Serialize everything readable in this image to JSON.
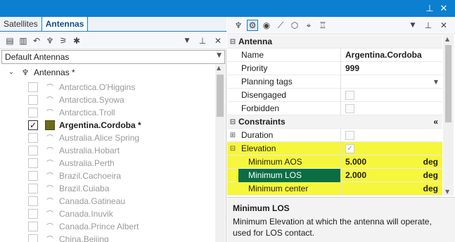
{
  "window": {
    "pin_icon": "pin-icon",
    "close_icon": "close-icon"
  },
  "left": {
    "tabs": [
      {
        "label": "Satellites"
      },
      {
        "label": "Antennas"
      }
    ],
    "filter": {
      "value": "Default Antennas"
    },
    "tree": {
      "root_label": "Antennas *",
      "items": [
        {
          "label": "Antarctica.O'Higgins",
          "checked": false,
          "bold": false
        },
        {
          "label": "Antarctica.Syowa",
          "checked": false,
          "bold": false
        },
        {
          "label": "Antarctica.Troll",
          "checked": false,
          "bold": false
        },
        {
          "label": "Argentina.Cordoba *",
          "checked": true,
          "bold": true
        },
        {
          "label": "Australia.Alice Spring",
          "checked": false,
          "bold": false
        },
        {
          "label": "Australia.Hobart",
          "checked": false,
          "bold": false
        },
        {
          "label": "Australia.Perth",
          "checked": false,
          "bold": false
        },
        {
          "label": "Brazil.Cachoeira",
          "checked": false,
          "bold": false
        },
        {
          "label": "Brazil.Cuiaba",
          "checked": false,
          "bold": false
        },
        {
          "label": "Canada.Gatineau",
          "checked": false,
          "bold": false
        },
        {
          "label": "Canada.Inuvik",
          "checked": false,
          "bold": false
        },
        {
          "label": "Canada.Prince Albert",
          "checked": false,
          "bold": false
        },
        {
          "label": "China.Beijing",
          "checked": false,
          "bold": false
        }
      ]
    }
  },
  "right": {
    "categories": {
      "antenna": "Antenna",
      "constraints": "Constraints"
    },
    "props": {
      "name": {
        "label": "Name",
        "value": "Argentina.Cordoba"
      },
      "priority": {
        "label": "Priority",
        "value": "999"
      },
      "planning_tags": {
        "label": "Planning tags",
        "value": ""
      },
      "disengaged": {
        "label": "Disengaged"
      },
      "forbidden": {
        "label": "Forbidden"
      },
      "duration": {
        "label": "Duration"
      },
      "elevation": {
        "label": "Elevation"
      },
      "min_aos": {
        "label": "Minimum AOS",
        "value": "5.000",
        "unit": "deg"
      },
      "min_los": {
        "label": "Minimum LOS",
        "value": "2.000",
        "unit": "deg"
      },
      "min_center": {
        "label": "Minimum center",
        "value": "",
        "unit": "deg"
      }
    },
    "collapse_glyph": "«",
    "description": {
      "title": "Minimum LOS",
      "text": "Minimum Elevation at which the antenna will operate, used for LOS contact."
    }
  }
}
